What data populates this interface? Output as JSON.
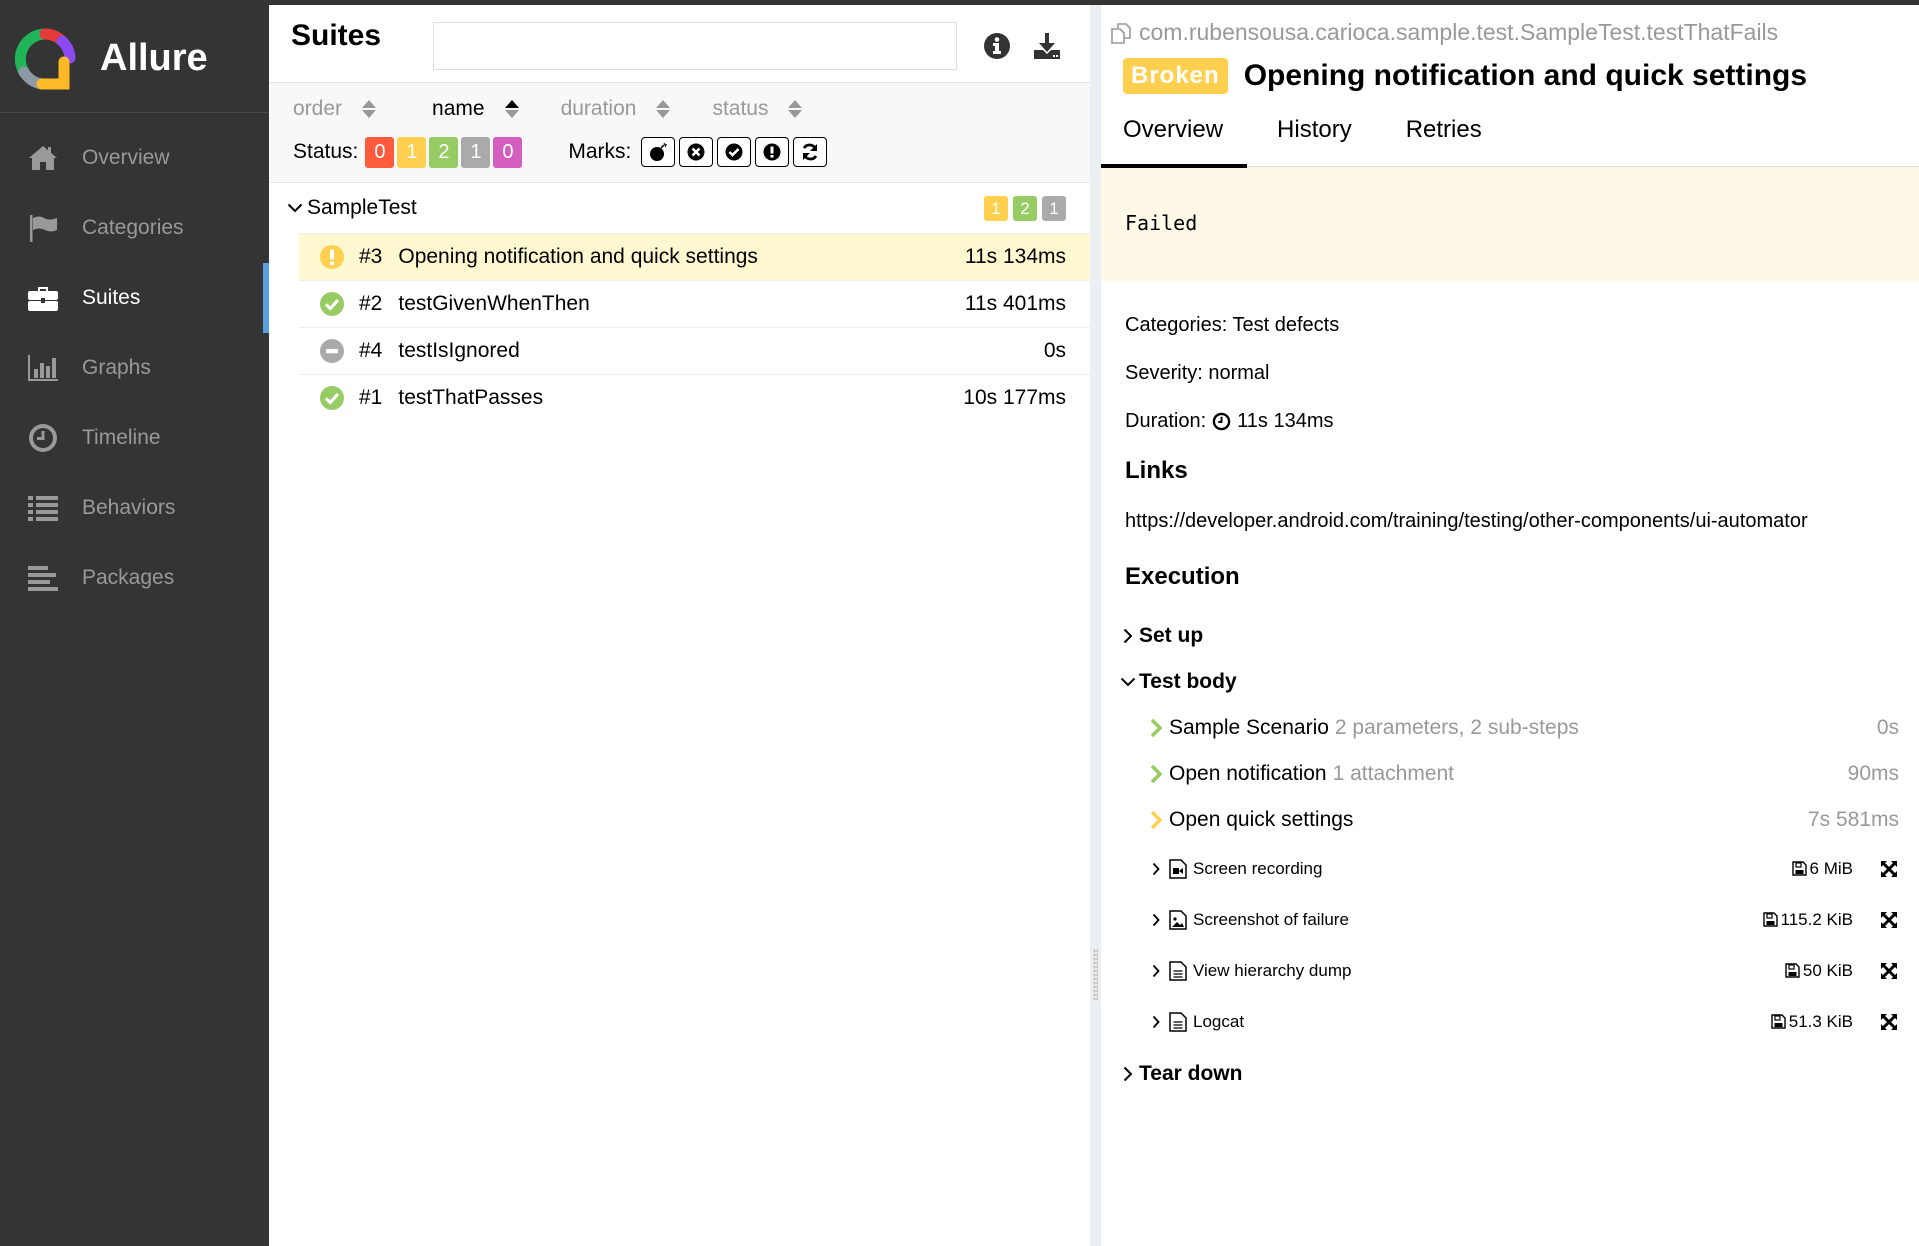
{
  "brand": {
    "name": "Allure"
  },
  "sidebar": {
    "items": [
      {
        "label": "Overview",
        "icon": "home-icon",
        "active": false
      },
      {
        "label": "Categories",
        "icon": "flag-icon",
        "active": false
      },
      {
        "label": "Suites",
        "icon": "briefcase-icon",
        "active": true
      },
      {
        "label": "Graphs",
        "icon": "bar-chart-icon",
        "active": false
      },
      {
        "label": "Timeline",
        "icon": "clock-icon",
        "active": false
      },
      {
        "label": "Behaviors",
        "icon": "list-icon",
        "active": false
      },
      {
        "label": "Packages",
        "icon": "align-left-icon",
        "active": false
      }
    ]
  },
  "suites": {
    "title": "Suites",
    "search": {
      "value": "",
      "placeholder": ""
    },
    "header_icons": [
      "info-icon",
      "download-icon"
    ],
    "sort": [
      {
        "label": "order",
        "active": false
      },
      {
        "label": "name",
        "active": true
      },
      {
        "label": "duration",
        "active": false
      },
      {
        "label": "status",
        "active": false
      }
    ],
    "status_label": "Status:",
    "status_counts": [
      {
        "name": "failed",
        "count": "0",
        "color": "#fd5a3e"
      },
      {
        "name": "broken",
        "count": "1",
        "color": "#ffd050"
      },
      {
        "name": "passed",
        "count": "2",
        "color": "#97cc64"
      },
      {
        "name": "skipped",
        "count": "1",
        "color": "#aaaaaa"
      },
      {
        "name": "unknown",
        "count": "0",
        "color": "#d35ebe"
      }
    ],
    "marks_label": "Marks:",
    "marks": [
      "bomb-icon",
      "times-circle-icon",
      "check-circle-icon",
      "exclamation-circle-icon",
      "refresh-icon"
    ],
    "group": {
      "name": "SampleTest",
      "counts": [
        {
          "count": "1",
          "color": "#ffd050"
        },
        {
          "count": "2",
          "color": "#97cc64"
        },
        {
          "count": "1",
          "color": "#aaaaaa"
        }
      ]
    },
    "tests": [
      {
        "num": "#3",
        "name": "Opening notification and quick settings",
        "duration": "11s 134ms",
        "status": "broken",
        "selected": true
      },
      {
        "num": "#2",
        "name": "testGivenWhenThen",
        "duration": "11s 401ms",
        "status": "passed",
        "selected": false
      },
      {
        "num": "#4",
        "name": "testIsIgnored",
        "duration": "0s",
        "status": "skipped",
        "selected": false
      },
      {
        "num": "#1",
        "name": "testThatPasses",
        "duration": "10s 177ms",
        "status": "passed",
        "selected": false
      }
    ]
  },
  "detail": {
    "full_name": "com.rubensousa.carioca.sample.test.SampleTest.testThatFails",
    "status_badge": "Broken",
    "title": "Opening notification and quick settings",
    "tabs": [
      {
        "label": "Overview",
        "active": true
      },
      {
        "label": "History",
        "active": false
      },
      {
        "label": "Retries",
        "active": false
      }
    ],
    "failure_message": "Failed",
    "categories": "Categories: Test defects",
    "severity": "Severity: normal",
    "duration_label": "Duration:",
    "duration_value": "11s 134ms",
    "links_title": "Links",
    "link": "https://developer.android.com/training/testing/other-components/ui-automator",
    "execution_title": "Execution",
    "stages": {
      "setup": {
        "label": "Set up",
        "expanded": false
      },
      "body": {
        "label": "Test body",
        "expanded": true
      },
      "teardown": {
        "label": "Tear down",
        "expanded": false
      }
    },
    "steps": [
      {
        "name": "Sample Scenario",
        "meta": "2 parameters, 2 sub-steps",
        "duration": "0s",
        "status": "passed",
        "color": "#97cc64"
      },
      {
        "name": "Open notification",
        "meta": "1 attachment",
        "duration": "90ms",
        "status": "passed",
        "color": "#97cc64"
      },
      {
        "name": "Open quick settings",
        "meta": "",
        "duration": "7s 581ms",
        "status": "broken",
        "color": "#ffd050"
      }
    ],
    "attachments": [
      {
        "name": "Screen recording",
        "size": "6 MiB",
        "icon": "file-video-icon"
      },
      {
        "name": "Screenshot of failure",
        "size": "115.2 KiB",
        "icon": "file-image-icon"
      },
      {
        "name": "View hierarchy dump",
        "size": "50 KiB",
        "icon": "file-text-icon"
      },
      {
        "name": "Logcat",
        "size": "51.3 KiB",
        "icon": "file-text-icon"
      }
    ]
  }
}
